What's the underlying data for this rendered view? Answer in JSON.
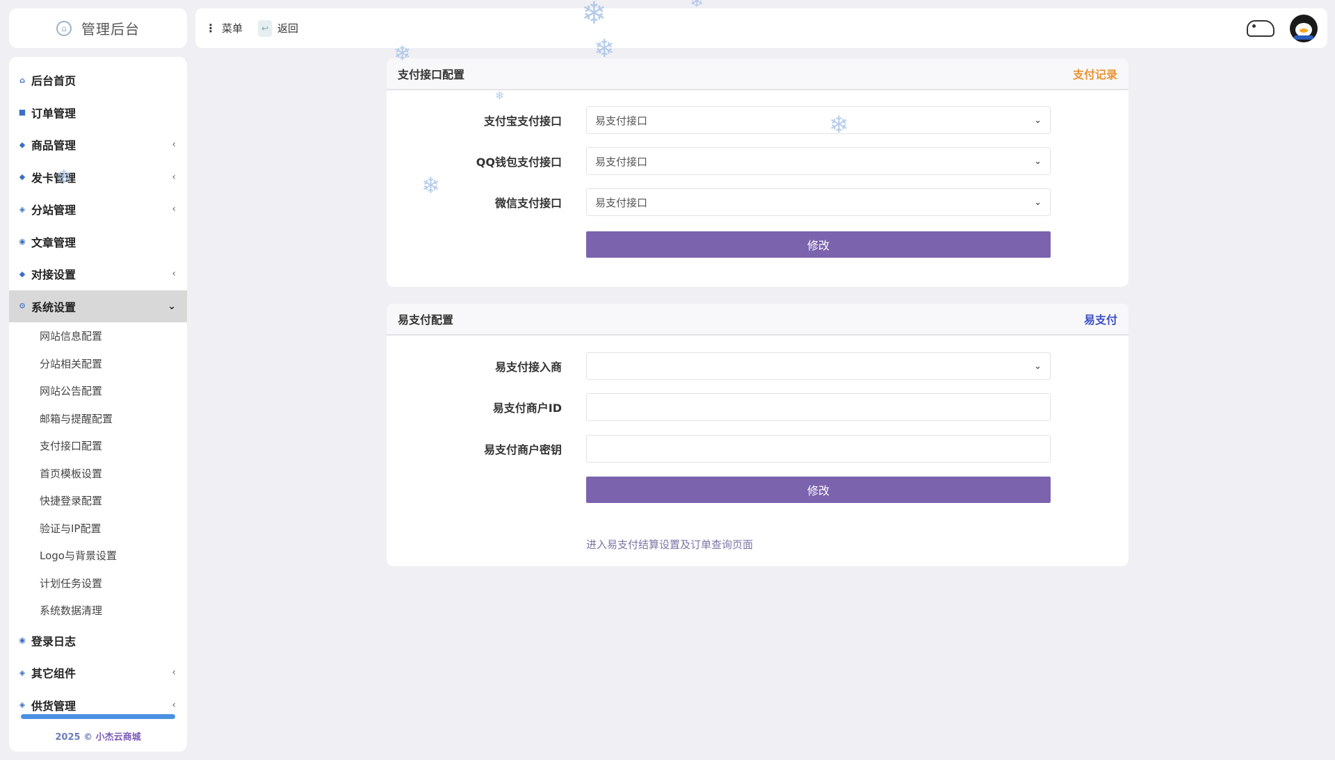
{
  "brand": {
    "name": "管理后台",
    "logo_icon": "⌂"
  },
  "sidebar": {
    "items": [
      {
        "label": "后台首页",
        "icon": "home-icon",
        "glyph": "⌂",
        "has_children": false
      },
      {
        "label": "订单管理",
        "icon": "folder-icon",
        "glyph": "■",
        "has_children": false
      },
      {
        "label": "商品管理",
        "icon": "products-icon",
        "glyph": "◆",
        "has_children": true
      },
      {
        "label": "发卡管理",
        "icon": "card-icon",
        "glyph": "◆",
        "has_children": true
      },
      {
        "label": "分站管理",
        "icon": "layers-icon",
        "glyph": "◈",
        "has_children": true
      },
      {
        "label": "文章管理",
        "icon": "article-icon",
        "glyph": "◉",
        "has_children": false
      },
      {
        "label": "对接设置",
        "icon": "link-icon",
        "glyph": "◆",
        "has_children": true
      },
      {
        "label": "系统设置",
        "icon": "settings-icon",
        "glyph": "⚙",
        "has_children": true,
        "expanded": true
      }
    ],
    "system_sub": [
      "网站信息配置",
      "分站相关配置",
      "网站公告配置",
      "邮箱与提醒配置",
      "支付接口配置",
      "首页模板设置",
      "快捷登录配置",
      "验证与IP配置",
      "Logo与背景设置",
      "计划任务设置",
      "系统数据清理"
    ],
    "items_after": [
      {
        "label": "登录日志",
        "icon": "log-icon",
        "glyph": "◉",
        "has_children": false
      },
      {
        "label": "其它组件",
        "icon": "components-icon",
        "glyph": "◈",
        "has_children": true
      },
      {
        "label": "供货管理",
        "icon": "supply-icon",
        "glyph": "◈",
        "has_children": true
      }
    ],
    "chevron_left": "‹",
    "chevron_down": "⌄",
    "copyright_year": "2025 ©",
    "copyright_brand": "小杰云商城"
  },
  "topbar": {
    "menu_label": "菜单",
    "back_label": "返回",
    "dots": "⋮"
  },
  "payment_config": {
    "title": "支付接口配置",
    "link": "支付记录",
    "fields": [
      {
        "label": "支付宝支付接口",
        "value": "易支付接口"
      },
      {
        "label": "QQ钱包支付接口",
        "value": "易支付接口"
      },
      {
        "label": "微信支付接口",
        "value": "易支付接口"
      }
    ],
    "submit": "修改"
  },
  "epay_config": {
    "title": "易支付配置",
    "link": "易支付",
    "fields": [
      {
        "label": "易支付接入商",
        "value": "",
        "type": "select"
      },
      {
        "label": "易支付商户ID",
        "value": "",
        "type": "input"
      },
      {
        "label": "易支付商户密钥",
        "value": "",
        "type": "input"
      }
    ],
    "submit": "修改",
    "help": "进入易支付结算设置及订单查询页面"
  },
  "colors": {
    "accent_button": "#7b63ad",
    "link_orange": "#e8922f",
    "link_blue": "#3c4fc4",
    "active_nav": "#d8d8d8"
  },
  "snowflake": "❄"
}
